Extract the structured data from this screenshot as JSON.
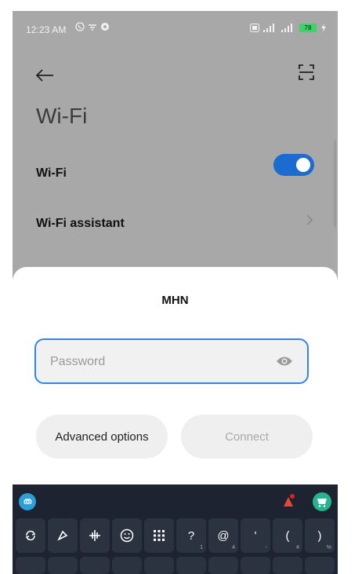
{
  "status_bar": {
    "time": "12:23 AM",
    "battery": "78"
  },
  "header": {
    "title": "Wi-Fi"
  },
  "settings": {
    "wifi_label": "Wi-Fi",
    "wifi_enabled": true,
    "assistant_label": "Wi-Fi assistant"
  },
  "dialog": {
    "network_name": "MHN",
    "password_placeholder": "Password",
    "password_value": "",
    "advanced_label": "Advanced options",
    "connect_label": "Connect"
  },
  "keyboard": {
    "logo": "ത",
    "symbol_keys": [
      {
        "label": "?",
        "hint": "1"
      },
      {
        "label": "@",
        "hint": "4"
      },
      {
        "label": "'",
        "hint": "-"
      },
      {
        "label": "(",
        "hint": "#"
      },
      {
        "label": ")",
        "hint": "%"
      }
    ]
  },
  "colors": {
    "accent": "#1b6bd1",
    "input_border": "#2f86e6",
    "keyboard_bg": "#1d2330",
    "battery": "#3fd16a"
  }
}
